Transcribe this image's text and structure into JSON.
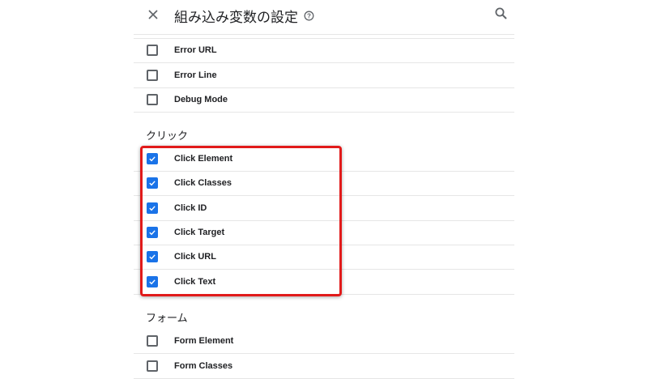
{
  "header": {
    "title": "組み込み変数の設定",
    "close_icon": "close-icon",
    "help_icon": "help-icon",
    "search_icon": "search-icon"
  },
  "groups": [
    {
      "title": "",
      "items": [
        {
          "label": "Error URL",
          "checked": false
        },
        {
          "label": "Error Line",
          "checked": false
        },
        {
          "label": "Debug Mode",
          "checked": false
        }
      ]
    },
    {
      "title": "クリック",
      "items": [
        {
          "label": "Click Element",
          "checked": true
        },
        {
          "label": "Click Classes",
          "checked": true
        },
        {
          "label": "Click ID",
          "checked": true
        },
        {
          "label": "Click Target",
          "checked": true
        },
        {
          "label": "Click URL",
          "checked": true
        },
        {
          "label": "Click Text",
          "checked": true
        }
      ]
    },
    {
      "title": "フォーム",
      "items": [
        {
          "label": "Form Element",
          "checked": false
        },
        {
          "label": "Form Classes",
          "checked": false
        }
      ]
    }
  ],
  "colors": {
    "checkbox_checked": "#1a73e8",
    "highlight_border": "#e11a1a"
  }
}
